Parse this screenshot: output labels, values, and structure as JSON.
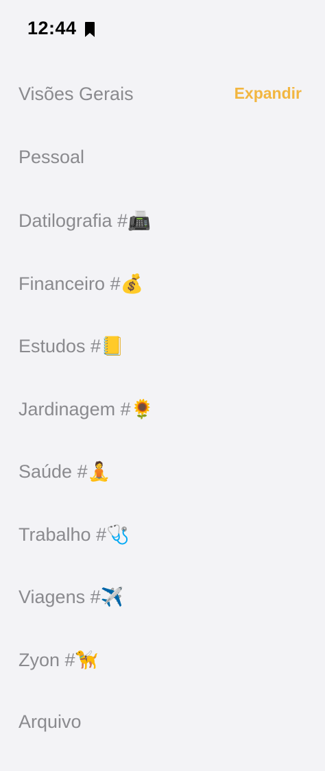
{
  "status_bar": {
    "time": "12:44",
    "icon": "bookmark-icon"
  },
  "header": {
    "title": "Visões Gerais",
    "expand_label": "Expandir",
    "accent_color": "#f2b640"
  },
  "items": [
    {
      "label": "Pessoal"
    },
    {
      "label": "Datilografia #📠"
    },
    {
      "label": "Financeiro #💰"
    },
    {
      "label": "Estudos #📒"
    },
    {
      "label": "Jardinagem #🌻"
    },
    {
      "label": "Saúde #🧘"
    },
    {
      "label": "Trabalho #🩺"
    },
    {
      "label": "Viagens #✈️"
    },
    {
      "label": "Zyon #🦮"
    },
    {
      "label": "Arquivo"
    }
  ]
}
